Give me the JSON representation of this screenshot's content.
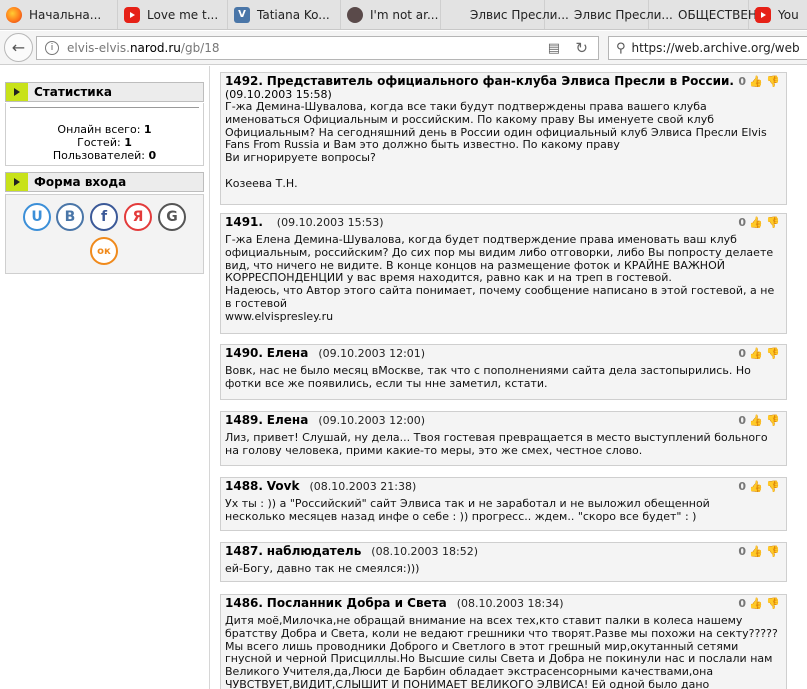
{
  "tabs": [
    {
      "label": "Начальна...",
      "icon": "firefox-icon"
    },
    {
      "label": "Love me t...",
      "icon": "youtube-icon"
    },
    {
      "label": "Tatiana Ko...",
      "icon": "vk-icon"
    },
    {
      "label": "I'm not ar...",
      "icon": "cloudflare-icon"
    },
    {
      "label": "Элвис Пресли...",
      "icon": "blank"
    },
    {
      "label": "Элвис Пресли...",
      "icon": "blank"
    },
    {
      "label": "ОБЩЕСТВЕН...",
      "icon": "blank"
    },
    {
      "label": "You",
      "icon": "youtube-icon"
    }
  ],
  "address": {
    "host_prefix": "elvis-elvis.",
    "host_domain": "narod.ru",
    "path": "/gb/18"
  },
  "search": {
    "value": "https://web.archive.org/web"
  },
  "sidebar": {
    "stats_title": "Статистика",
    "online_total_label": "Онлайн всего:",
    "online_total": "1",
    "guests_label": "Гостей:",
    "guests": "1",
    "users_label": "Пользователей:",
    "users": "0",
    "login_title": "Форма входа",
    "social": [
      {
        "name": "ucoz",
        "glyph": "U",
        "color": "#3b8fd8"
      },
      {
        "name": "vk",
        "glyph": "B",
        "color": "#4a76a8"
      },
      {
        "name": "facebook",
        "glyph": "f",
        "color": "#3b5998"
      },
      {
        "name": "yandex",
        "glyph": "Я",
        "color": "#e33b3b"
      },
      {
        "name": "google",
        "glyph": "G",
        "color": "#555555"
      },
      {
        "name": "odnoklassniki",
        "glyph": "ок",
        "color": "#f08a1c"
      }
    ]
  },
  "posts": [
    {
      "num": "1492.",
      "title": "Представитель официального фан-клуба Элвиса Пресли в России.",
      "date": "(09.10.2003 15:58)",
      "rating": "0",
      "date_newline": true,
      "lines": [
        "Г-жа Демина-Шувалова, когда все таки будут подтверждены права вашего клуба",
        "именоваться Официальным и российским. По какому праву Вы именуете свой клуб",
        "Официальным? На сегодняшний день в России один официальный клуб Элвиса Пресли Elvis",
        "Fans From Russia и Вам это должно быть известно. По какому праву",
        "Ви игнорируете вопросы?",
        "",
        "Козеева Т.Н."
      ]
    },
    {
      "num": "1491.",
      "title": "",
      "date": "(09.10.2003 15:53)",
      "rating": "0",
      "lines": [
        "Г-жа Елена Демина-Шувалова, когда будет подтверждение права именовать ваш клуб",
        "официальным, российским? До сих пор мы видим либо отговорки, либо Вы попросту делаете",
        "вид, что ничего не видите. В конце концов на размещение фоток и КРАЙНЕ ВАЖНОЙ",
        "КОРРЕСПОНДЕНЦИИ у вас время находится, равно как и на треп в гостевой.",
        "Надеюсь, что Автор этого сайта понимает, почему сообщение написано в этой гостевой, а не",
        "в гостевой",
        "www.elvispresley.ru"
      ]
    },
    {
      "num": "1490.",
      "title": "Елена",
      "date": "(09.10.2003 12:01)",
      "rating": "0",
      "lines": [
        "Вовк, нас не было месяц вМоскве, так что с пополнениями сайта дела застопырились. Но",
        "фотки все же появились, если ты нне заметил, кстати."
      ]
    },
    {
      "num": "1489.",
      "title": "Елена",
      "date": "(09.10.2003 12:00)",
      "rating": "0",
      "lines": [
        "Лиз, привет! Слушай, ну дела... Твоя гостевая превращается в место выступлений больного",
        "на голову человека, прими какие-то меры, это же смех, честное слово."
      ]
    },
    {
      "num": "1488.",
      "title": "Vovk",
      "date": "(08.10.2003 21:38)",
      "rating": "0",
      "lines": [
        "Ух ты : )) а \"Российский\" сайт Элвиса так и не заработал и не выложил обещенной",
        "несколько месяцев назад инфе о себе : )) прогресс.. ждем.. \"скоро все будет\" : )"
      ]
    },
    {
      "num": "1487.",
      "title": "наблюдатель",
      "date": "(08.10.2003 18:52)",
      "rating": "0",
      "lines": [
        "ей-Богу, давно так не смеялся:)))"
      ]
    },
    {
      "num": "1486.",
      "title": "Посланник Добра и Света",
      "date": "(08.10.2003 18:34)",
      "rating": "0",
      "lines": [
        "Дитя моё,Милочка,не обращай внимание на всех тех,кто ставит палки в колеса нашему",
        "братству Добра и Света, коли не ведают грешники что творят.Разве мы похожи на секту?????",
        "Мы всего лишь проводники Доброго и Светлого в этот грешный мир,окутанный сетями",
        "гнусной и черной Присциллы.Но Высшие силы Света и Добра не покинули нас и послали нам",
        "Великого Учителя,да,Люси де Барбин обладает экстрасенсорными качествами,она",
        "ЧУВСТВУЕТ,ВИДИТ,СЛЫШИТ И ПОНИМАЕТ ВЕЛИКОГО ЭЛВИСА! Ей одной было дано"
      ]
    }
  ]
}
